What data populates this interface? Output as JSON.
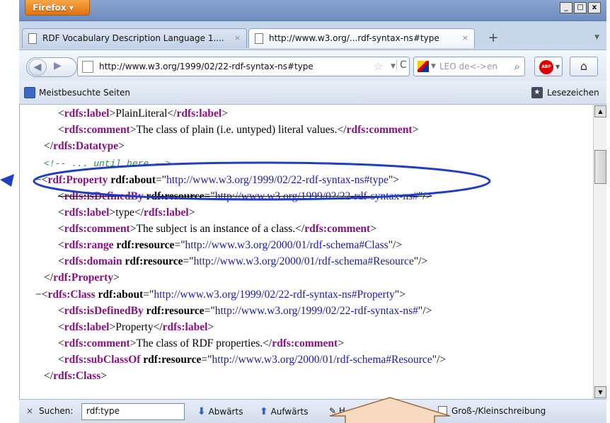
{
  "titlebar": {
    "app_button": "Firefox ▾",
    "minimize": "_",
    "maximize": "□",
    "close": "x"
  },
  "tabs": [
    {
      "title": "RDF Vocabulary Description Language 1....",
      "close": "×"
    },
    {
      "title": "http://www.w3.org/...rdf-syntax-ns#type",
      "close": "×"
    }
  ],
  "newtab": "+",
  "navbar": {
    "url": "http://www.w3.org/1999/02/22-rdf-syntax-ns#type",
    "search_placeholder": "LEO de<->en",
    "abp_label": "ABP"
  },
  "bookmarks": {
    "most_visited": "Meistbesuchte Seiten",
    "bookmarks": "Lesezeichen"
  },
  "xml": {
    "l1": {
      "o": "<",
      "tag": "rdfs:label",
      "c": ">",
      "text": "PlainLiteral",
      "o2": "</",
      "tag2": "rdfs:label",
      "c2": ">"
    },
    "l2": {
      "o": "<",
      "tag": "rdfs:comment",
      "c": ">",
      "text": "The class of plain (i.e. untyped) literal values.",
      "o2": "</",
      "tag2": "rdfs:comment",
      "c2": ">"
    },
    "l3": {
      "o": "</",
      "tag": "rdfs:Datatype",
      "c": ">"
    },
    "l4": {
      "comment": "<!-- ... until here -->"
    },
    "l5": {
      "minus": "−",
      "o": "<",
      "tag": "rdf:Property",
      "attr": " rdf:about",
      "eq": "=\"",
      "val": "http://www.w3.org/1999/02/22-rdf-syntax-ns#type",
      "c": "\">"
    },
    "l6": {
      "o": "<",
      "tag": "rdfs:isDefinedBy",
      "attr": " rdf:resource",
      "eq": "=\"",
      "val": "http://www.w3.org/1999/02/22-rdf-syntax-ns#",
      "c": "\"/>"
    },
    "l7": {
      "o": "<",
      "tag": "rdfs:label",
      "c": ">",
      "text": "type",
      "o2": "</",
      "tag2": "rdfs:label",
      "c2": ">"
    },
    "l8": {
      "o": "<",
      "tag": "rdfs:comment",
      "c": ">",
      "text": "The subject is an instance of a class.",
      "o2": "</",
      "tag2": "rdfs:comment",
      "c2": ">"
    },
    "l9": {
      "o": "<",
      "tag": "rdfs:range",
      "attr": " rdf:resource",
      "eq": "=\"",
      "val": "http://www.w3.org/2000/01/rdf-schema#Class",
      "c": "\"/>"
    },
    "l10": {
      "o": "<",
      "tag": "rdfs:domain",
      "attr": " rdf:resource",
      "eq": "=\"",
      "val": "http://www.w3.org/2000/01/rdf-schema#Resource",
      "c": "\"/>"
    },
    "l11": {
      "o": "</",
      "tag": "rdf:Property",
      "c": ">"
    },
    "l12": {
      "minus": "−",
      "o": "<",
      "tag": "rdfs:Class",
      "attr": " rdf:about",
      "eq": "=\"",
      "val": "http://www.w3.org/1999/02/22-rdf-syntax-ns#Property",
      "c": "\">"
    },
    "l13": {
      "o": "<",
      "tag": "rdfs:isDefinedBy",
      "attr": " rdf:resource",
      "eq": "=\"",
      "val": "http://www.w3.org/1999/02/22-rdf-syntax-ns#",
      "c": "\"/>"
    },
    "l14": {
      "o": "<",
      "tag": "rdfs:label",
      "c": ">",
      "text": "Property",
      "o2": "</",
      "tag2": "rdfs:label",
      "c2": ">"
    },
    "l15": {
      "o": "<",
      "tag": "rdfs:comment",
      "c": ">",
      "text": "The class of RDF properties.",
      "o2": "</",
      "tag2": "rdfs:comment",
      "c2": ">"
    },
    "l16": {
      "o": "<",
      "tag": "rdfs:subClassOf",
      "attr": " rdf:resource",
      "eq": "=\"",
      "val": "http://www.w3.org/2000/01/rdf-schema#Resource",
      "c": "\"/>"
    },
    "l17": {
      "o": "</",
      "tag": "rdfs:Class",
      "c": ">"
    }
  },
  "findbar": {
    "close": "×",
    "label": "Suchen:",
    "value": "rdf:type",
    "down": "Abwärts",
    "up": "Aufwärts",
    "highlight": "H",
    "match_case": "Groß-/Kleinschreibung"
  },
  "colors": {
    "tag": "#881280",
    "attr_value": "#1a1aa6",
    "comment": "#2e8b57",
    "annotation": "#1f3fbf"
  }
}
